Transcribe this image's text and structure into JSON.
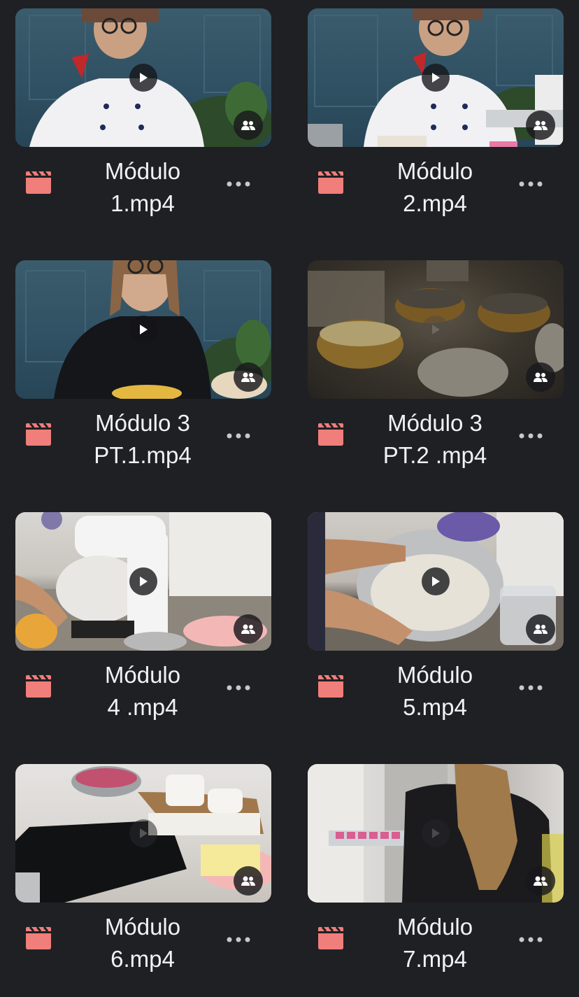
{
  "files": [
    {
      "name": "Módulo\n1.mp4",
      "scene": "chef-blue"
    },
    {
      "name": "Módulo\n2.mp4",
      "scene": "chef-blue-2"
    },
    {
      "name": "Módulo 3\nPT.1.mp4",
      "scene": "black-shirt-blue"
    },
    {
      "name": "Módulo 3\nPT.2 .mp4",
      "scene": "bowls-dark"
    },
    {
      "name": "Módulo\n4 .mp4",
      "scene": "mixer-kitchen"
    },
    {
      "name": "Módulo\n5.mp4",
      "scene": "steel-bowl"
    },
    {
      "name": "Módulo\n6.mp4",
      "scene": "pink-bowl-table"
    },
    {
      "name": "Módulo\n7.mp4",
      "scene": "fridge-woman"
    }
  ],
  "colors": {
    "background": "#1f2024",
    "file_icon": "#f07e7a",
    "text": "#f2f2f4",
    "dots": "#c8c8cc"
  },
  "icons": {
    "file": "video-file-icon",
    "play": "play-icon",
    "shared": "shared-people-icon",
    "more": "more-horizontal-icon"
  }
}
